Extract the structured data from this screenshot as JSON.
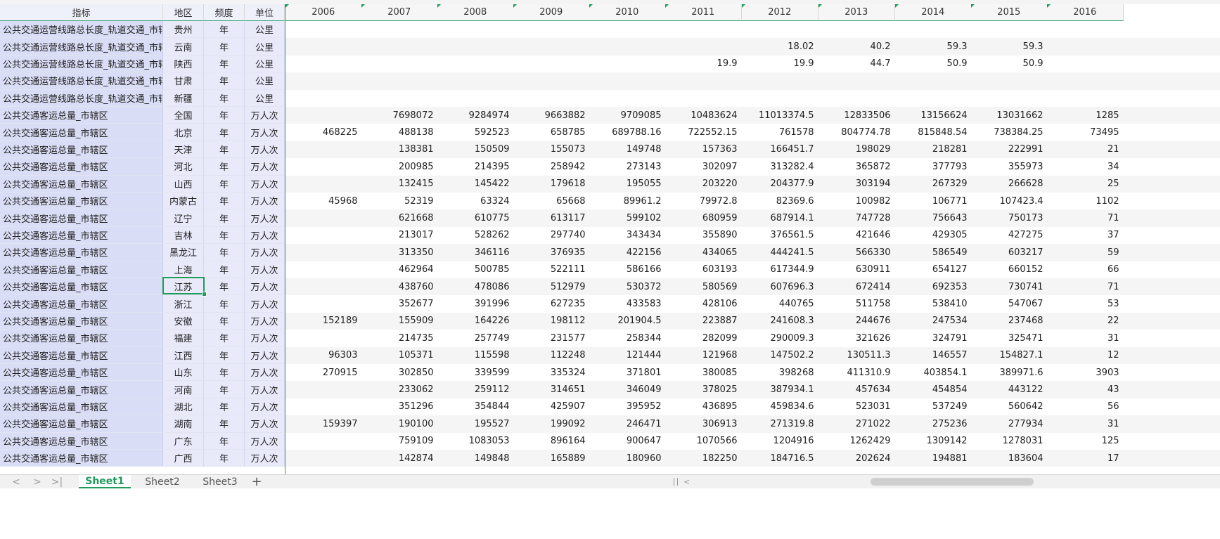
{
  "headers": {
    "indicator": "指标",
    "region": "地区",
    "frequency": "频度",
    "unit": "单位",
    "years": [
      "2006",
      "2007",
      "2008",
      "2009",
      "2010",
      "2011",
      "2012",
      "2013",
      "2014",
      "2015",
      "2016"
    ]
  },
  "rows": [
    {
      "indicator": "公共交通运营线路总长度_轨道交通_市辖",
      "region": "贵州",
      "frequency": "年",
      "unit": "公里",
      "values": [
        "",
        "",
        "",
        "",
        "",
        "",
        "",
        "",
        "",
        "",
        ""
      ]
    },
    {
      "indicator": "公共交通运营线路总长度_轨道交通_市辖",
      "region": "云南",
      "frequency": "年",
      "unit": "公里",
      "values": [
        "",
        "",
        "",
        "",
        "",
        "",
        "18.02",
        "40.2",
        "59.3",
        "59.3",
        ""
      ]
    },
    {
      "indicator": "公共交通运营线路总长度_轨道交通_市辖",
      "region": "陕西",
      "frequency": "年",
      "unit": "公里",
      "values": [
        "",
        "",
        "",
        "",
        "",
        "19.9",
        "19.9",
        "44.7",
        "50.9",
        "50.9",
        ""
      ]
    },
    {
      "indicator": "公共交通运营线路总长度_轨道交通_市辖",
      "region": "甘肃",
      "frequency": "年",
      "unit": "公里",
      "values": [
        "",
        "",
        "",
        "",
        "",
        "",
        "",
        "",
        "",
        "",
        ""
      ]
    },
    {
      "indicator": "公共交通运营线路总长度_轨道交通_市辖",
      "region": "新疆",
      "frequency": "年",
      "unit": "公里",
      "values": [
        "",
        "",
        "",
        "",
        "",
        "",
        "",
        "",
        "",
        "",
        ""
      ]
    },
    {
      "indicator": "公共交通客运总量_市辖区",
      "region": "全国",
      "frequency": "年",
      "unit": "万人次",
      "values": [
        "",
        "7698072",
        "9284974",
        "9663882",
        "9709085",
        "10483624",
        "11013374.5",
        "12833506",
        "13156624",
        "13031662",
        "1285"
      ]
    },
    {
      "indicator": "公共交通客运总量_市辖区",
      "region": "北京",
      "frequency": "年",
      "unit": "万人次",
      "values": [
        "468225",
        "488138",
        "592523",
        "658785",
        "689788.16",
        "722552.15",
        "761578",
        "804774.78",
        "815848.54",
        "738384.25",
        "73495"
      ]
    },
    {
      "indicator": "公共交通客运总量_市辖区",
      "region": "天津",
      "frequency": "年",
      "unit": "万人次",
      "values": [
        "",
        "138381",
        "150509",
        "155073",
        "149748",
        "157363",
        "166451.7",
        "198029",
        "218281",
        "222991",
        "21"
      ]
    },
    {
      "indicator": "公共交通客运总量_市辖区",
      "region": "河北",
      "frequency": "年",
      "unit": "万人次",
      "values": [
        "",
        "200985",
        "214395",
        "258942",
        "273143",
        "302097",
        "313282.4",
        "365872",
        "377793",
        "355973",
        "34"
      ]
    },
    {
      "indicator": "公共交通客运总量_市辖区",
      "region": "山西",
      "frequency": "年",
      "unit": "万人次",
      "values": [
        "",
        "132415",
        "145422",
        "179618",
        "195055",
        "203220",
        "204377.9",
        "303194",
        "267329",
        "266628",
        "25"
      ]
    },
    {
      "indicator": "公共交通客运总量_市辖区",
      "region": "内蒙古",
      "frequency": "年",
      "unit": "万人次",
      "values": [
        "45968",
        "52319",
        "63324",
        "65668",
        "89961.2",
        "79972.8",
        "82369.6",
        "100982",
        "106771",
        "107423.4",
        "1102"
      ]
    },
    {
      "indicator": "公共交通客运总量_市辖区",
      "region": "辽宁",
      "frequency": "年",
      "unit": "万人次",
      "values": [
        "",
        "621668",
        "610775",
        "613117",
        "599102",
        "680959",
        "687914.1",
        "747728",
        "756643",
        "750173",
        "71"
      ]
    },
    {
      "indicator": "公共交通客运总量_市辖区",
      "region": "吉林",
      "frequency": "年",
      "unit": "万人次",
      "values": [
        "",
        "213017",
        "528262",
        "297740",
        "343434",
        "355890",
        "376561.5",
        "421646",
        "429305",
        "427275",
        "37"
      ]
    },
    {
      "indicator": "公共交通客运总量_市辖区",
      "region": "黑龙江",
      "frequency": "年",
      "unit": "万人次",
      "values": [
        "",
        "313350",
        "346116",
        "376935",
        "422156",
        "434065",
        "444241.5",
        "566330",
        "586549",
        "603217",
        "59"
      ]
    },
    {
      "indicator": "公共交通客运总量_市辖区",
      "region": "上海",
      "frequency": "年",
      "unit": "万人次",
      "values": [
        "",
        "462964",
        "500785",
        "522111",
        "586166",
        "603193",
        "617344.9",
        "630911",
        "654127",
        "660152",
        "66"
      ]
    },
    {
      "indicator": "公共交通客运总量_市辖区",
      "region": "江苏",
      "frequency": "年",
      "unit": "万人次",
      "values": [
        "",
        "438760",
        "478086",
        "512979",
        "530372",
        "580569",
        "607696.3",
        "672414",
        "692353",
        "730741",
        "71"
      ]
    },
    {
      "indicator": "公共交通客运总量_市辖区",
      "region": "浙江",
      "frequency": "年",
      "unit": "万人次",
      "values": [
        "",
        "352677",
        "391996",
        "627235",
        "433583",
        "428106",
        "440765",
        "511758",
        "538410",
        "547067",
        "53"
      ]
    },
    {
      "indicator": "公共交通客运总量_市辖区",
      "region": "安徽",
      "frequency": "年",
      "unit": "万人次",
      "values": [
        "152189",
        "155909",
        "164226",
        "198112",
        "201904.5",
        "223887",
        "241608.3",
        "244676",
        "247534",
        "237468",
        "22"
      ]
    },
    {
      "indicator": "公共交通客运总量_市辖区",
      "region": "福建",
      "frequency": "年",
      "unit": "万人次",
      "values": [
        "",
        "214735",
        "257749",
        "231577",
        "258344",
        "282099",
        "290009.3",
        "321626",
        "324791",
        "325471",
        "31"
      ]
    },
    {
      "indicator": "公共交通客运总量_市辖区",
      "region": "江西",
      "frequency": "年",
      "unit": "万人次",
      "values": [
        "96303",
        "105371",
        "115598",
        "112248",
        "121444",
        "121968",
        "147502.2",
        "130511.3",
        "146557",
        "154827.1",
        "12"
      ]
    },
    {
      "indicator": "公共交通客运总量_市辖区",
      "region": "山东",
      "frequency": "年",
      "unit": "万人次",
      "values": [
        "270915",
        "302850",
        "339599",
        "335324",
        "371801",
        "380085",
        "398268",
        "411310.9",
        "403854.1",
        "389971.6",
        "3903"
      ]
    },
    {
      "indicator": "公共交通客运总量_市辖区",
      "region": "河南",
      "frequency": "年",
      "unit": "万人次",
      "values": [
        "",
        "233062",
        "259112",
        "314651",
        "346049",
        "378025",
        "387934.1",
        "457634",
        "454854",
        "443122",
        "43"
      ]
    },
    {
      "indicator": "公共交通客运总量_市辖区",
      "region": "湖北",
      "frequency": "年",
      "unit": "万人次",
      "values": [
        "",
        "351296",
        "354844",
        "425907",
        "395952",
        "436895",
        "459834.6",
        "523031",
        "537249",
        "560642",
        "56"
      ]
    },
    {
      "indicator": "公共交通客运总量_市辖区",
      "region": "湖南",
      "frequency": "年",
      "unit": "万人次",
      "values": [
        "159397",
        "190100",
        "195527",
        "199092",
        "246471",
        "306913",
        "271319.8",
        "271022",
        "275236",
        "277934",
        "31"
      ]
    },
    {
      "indicator": "公共交通客运总量_市辖区",
      "region": "广东",
      "frequency": "年",
      "unit": "万人次",
      "values": [
        "",
        "759109",
        "1083053",
        "896164",
        "900647",
        "1070566",
        "1204916",
        "1262429",
        "1309142",
        "1278031",
        "125"
      ]
    },
    {
      "indicator": "公共交通客运总量_市辖区",
      "region": "广西",
      "frequency": "年",
      "unit": "万人次",
      "values": [
        "",
        "142874",
        "149848",
        "165889",
        "180960",
        "182250",
        "184716.5",
        "202624",
        "194881",
        "183604",
        "17"
      ]
    }
  ],
  "tabs": [
    "Sheet1",
    "Sheet2",
    "Sheet3"
  ],
  "active_tab": "Sheet1",
  "icons": {
    "nav_first": "|<",
    "nav_prev": "<",
    "nav_next": ">",
    "nav_last": ">|",
    "add_sheet": "+"
  },
  "colors": {
    "accent": "#1f9b5b",
    "frozen_column": "#d9ddf5"
  }
}
